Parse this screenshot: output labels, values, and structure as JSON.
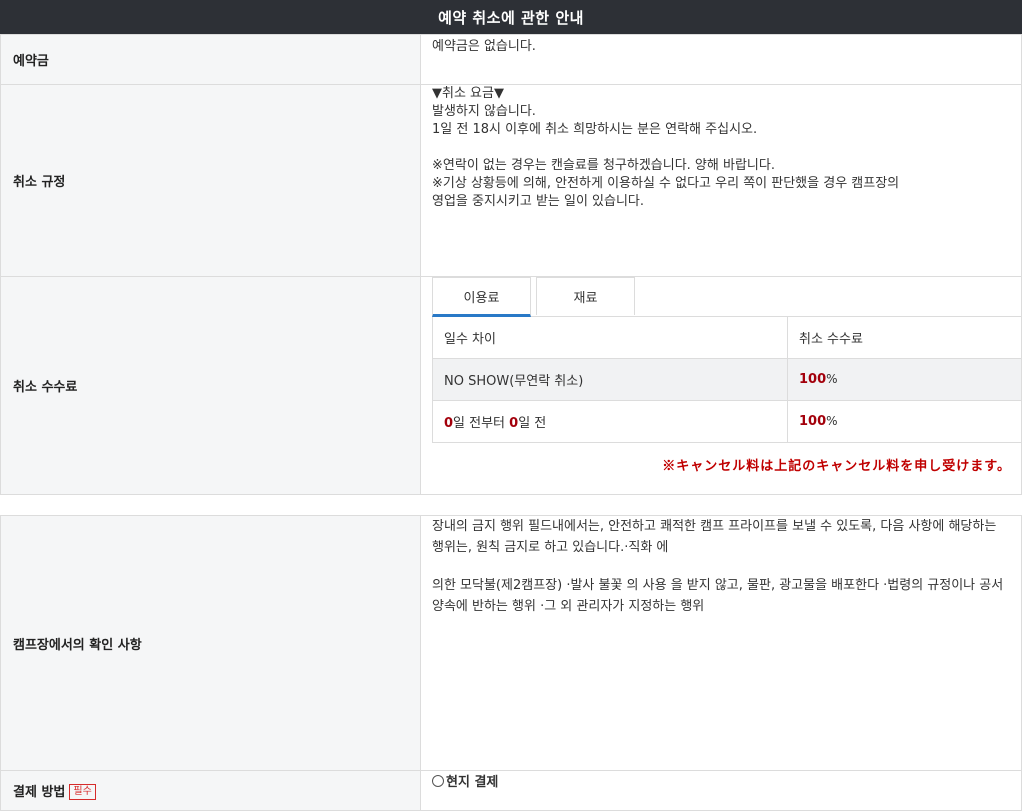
{
  "header": {
    "title": "예약 취소에 관한 안내"
  },
  "deposit": {
    "label": "예약금",
    "value": "예약금은 없습니다."
  },
  "rules": {
    "label": "취소 규정",
    "lines": [
      "▼취소 요금▼",
      "발생하지 않습니다.",
      "1일 전 18시 이후에 취소 희망하시는 분은 연락해 주십시오.",
      "",
      "※연락이 없는 경우는 캔슬료를 청구하겠습니다. 양해 바랍니다.",
      "※기상 상황등에 의해, 안전하게 이용하실 수 없다고 우리 쪽이 판단했을 경우 캠프장의",
      "영업을 중지시키고 받는 일이 있습니다."
    ]
  },
  "fees": {
    "label": "취소 수수료",
    "tabs": [
      "이용료",
      "재료"
    ],
    "table": {
      "headers": [
        "일수 차이",
        "취소 수수료"
      ],
      "rows": [
        {
          "days_text": "NO SHOW(무연락 취소)",
          "fee_value": "100",
          "fee_unit": "%"
        },
        {
          "day_from": "0",
          "from_text": "일 전부터 ",
          "day_to": "0",
          "to_text": "일 전",
          "fee_value": "100",
          "fee_unit": "%"
        }
      ]
    },
    "note": "※キャンセル料は上記のキャンセル料を申し受けます。"
  },
  "campsite": {
    "label": "캠프장에서의 확인 사항",
    "paragraphs": [
      "장내의 금지 행위 필드내에서는, 안전하고 쾌적한 캠프 프라이프를 보낼 수 있도록, 다음 사항에 해당하는 행위는, 원칙 금지로 하고 있습니다.·직화 에",
      "의한 모닥불(제2캠프장) ·발사 불꽃 의 사용 을 받지 않고, 물판, 광고물을 배포한다 ·법령의 규정이나 공서 양속에 반하는 행위 ·그 외 관리자가 지정하는 행위"
    ]
  },
  "payment": {
    "label": "결제 방법",
    "required_badge": "필수",
    "option": "현지 결제"
  }
}
